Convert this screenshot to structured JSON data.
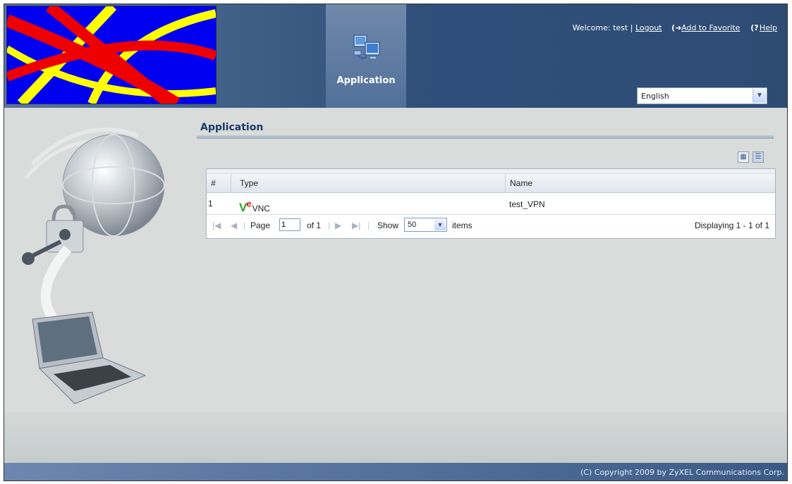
{
  "header": {
    "tab_label": "Application",
    "welcome": "Welcome: test",
    "separator": "|",
    "logout": "Logout",
    "add_favorite": "Add to Favorite",
    "help": "Help",
    "language": "English"
  },
  "page": {
    "title": "Application"
  },
  "grid": {
    "columns": [
      "#",
      "Type",
      "Name"
    ],
    "rows": [
      {
        "num": "1",
        "type_icon": "V2",
        "type": "VNC",
        "name": "test_VPN"
      }
    ]
  },
  "pager": {
    "page_label": "Page",
    "page_value": "1",
    "of_label": "of 1",
    "show_label": "Show",
    "show_value": "50",
    "items_label": "items",
    "display": "Displaying 1 - 1 of 1"
  },
  "footer": {
    "copyright": "(C) Copyright 2009 by ZyXEL Communications Corp."
  }
}
